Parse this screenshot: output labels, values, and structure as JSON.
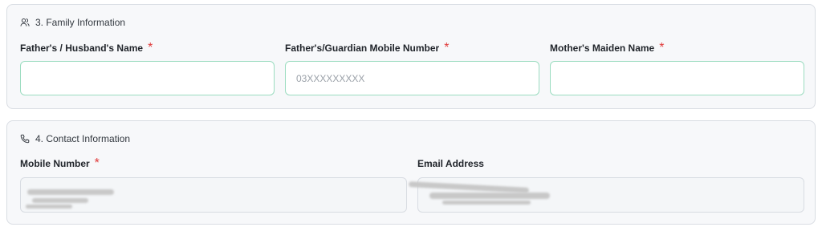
{
  "family": {
    "title": "3. Family Information",
    "icon": "users-icon",
    "fathers_name": {
      "label": "Father's / Husband's Name",
      "required": "*",
      "value": "",
      "placeholder": ""
    },
    "guardian_mobile": {
      "label": "Father's/Guardian Mobile Number",
      "required": "*",
      "value": "",
      "placeholder": "03XXXXXXXXX"
    },
    "mothers_maiden_name": {
      "label": "Mother's Maiden Name",
      "required": "*",
      "value": "",
      "placeholder": ""
    }
  },
  "contact": {
    "title": "4. Contact Information",
    "icon": "phone-icon",
    "mobile_number": {
      "label": "Mobile Number",
      "required": "*"
    },
    "email_address": {
      "label": "Email Address"
    }
  },
  "colors": {
    "required": "#e03a3a",
    "input_border_active": "#9bdcc0",
    "card_background": "#f7f8fa"
  }
}
